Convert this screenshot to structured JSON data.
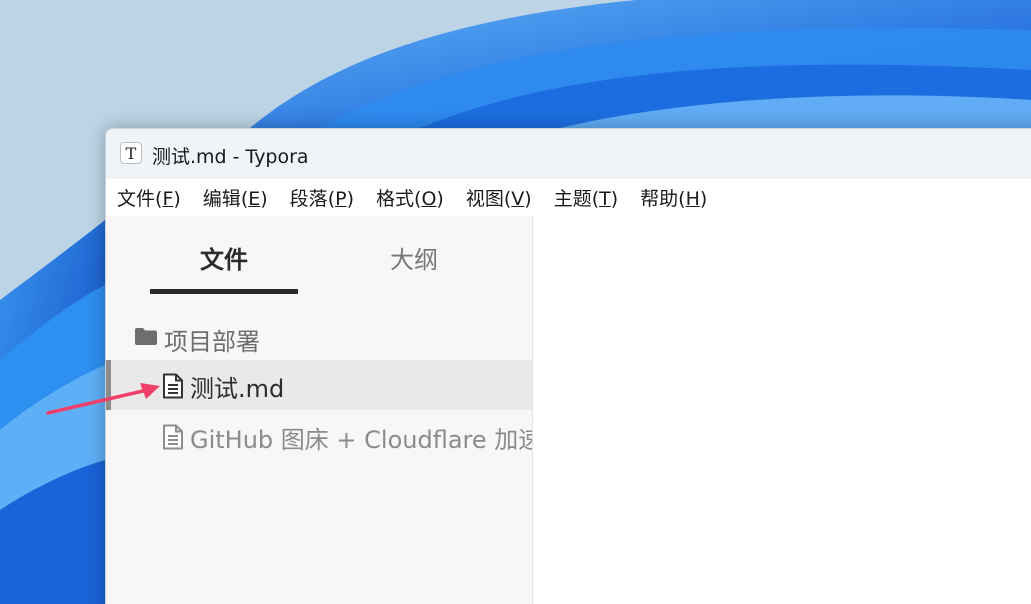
{
  "window": {
    "title": "测试.md - Typora",
    "app_icon_glyph": "T"
  },
  "menubar": {
    "items": [
      {
        "label": "文件",
        "mnemonic": "F"
      },
      {
        "label": "编辑",
        "mnemonic": "E"
      },
      {
        "label": "段落",
        "mnemonic": "P"
      },
      {
        "label": "格式",
        "mnemonic": "O"
      },
      {
        "label": "视图",
        "mnemonic": "V"
      },
      {
        "label": "主题",
        "mnemonic": "T"
      },
      {
        "label": "帮助",
        "mnemonic": "H"
      }
    ]
  },
  "sidebar": {
    "tabs": {
      "files": "文件",
      "outline": "大纲"
    },
    "active_tab": "files",
    "folder": {
      "name": "项目部署",
      "icon": "folder-icon"
    },
    "files": [
      {
        "name": "测试.md",
        "icon": "document-icon",
        "active": true
      },
      {
        "name": "GitHub 图床 + Cloudflare 加速 部",
        "icon": "document-icon",
        "active": false
      }
    ]
  },
  "annotation": {
    "type": "arrow",
    "color": "#f0406a"
  },
  "colors": {
    "titlebar": "#eff4f9",
    "sidebar": "#f7f7f7",
    "active_row": "#e9e9e9",
    "wallpaper_blue": "#1e6fe0"
  }
}
